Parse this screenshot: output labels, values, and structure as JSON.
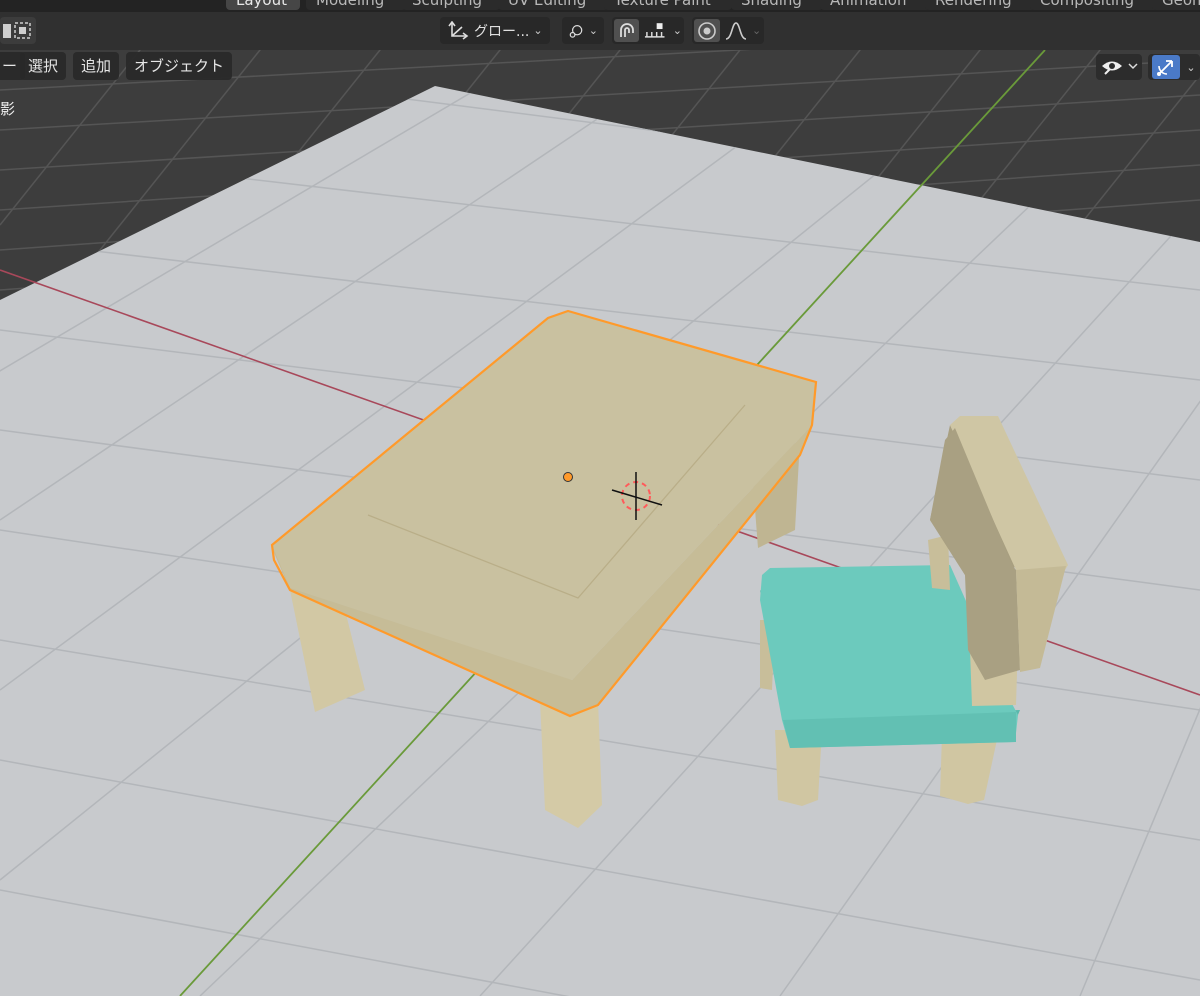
{
  "workspace_tabs": [
    {
      "label": "Layout",
      "active": true
    },
    {
      "label": "Modeling"
    },
    {
      "label": "Sculpting"
    },
    {
      "label": "UV Editing"
    },
    {
      "label": "Texture Paint"
    },
    {
      "label": "Shading"
    },
    {
      "label": "Animation"
    },
    {
      "label": "Rendering"
    },
    {
      "label": "Compositing"
    },
    {
      "label": "Geometry Nodes"
    }
  ],
  "header": {
    "transform_orientation": "グロー...",
    "icons": [
      "select-box-icon",
      "transform-orientation-icon",
      "pivot-point-icon",
      "snap-magnet-icon",
      "snap-increment-icon",
      "proportional-editing-icon",
      "falloff-curve-icon"
    ]
  },
  "menus": [
    "ー",
    "選択",
    "追加",
    "オブジェクト"
  ],
  "viewport_overlay": {
    "status_text": "影",
    "icons": [
      "visibility-eye-icon",
      "gizmo-icon"
    ]
  },
  "scene": {
    "objects": [
      {
        "name": "table",
        "selected": true
      },
      {
        "name": "chair",
        "selected": false
      }
    ],
    "colors": {
      "floor": "#c8cacd",
      "floor_grid": "#b4b7bb",
      "background": "#3d3d3d",
      "grid_dark": "#555555",
      "x_axis": "#a8485a",
      "y_axis": "#6a9a3a",
      "selection": "#ff9a2a",
      "wood": "#cdc3a0",
      "seat": "#6ccabd"
    }
  }
}
